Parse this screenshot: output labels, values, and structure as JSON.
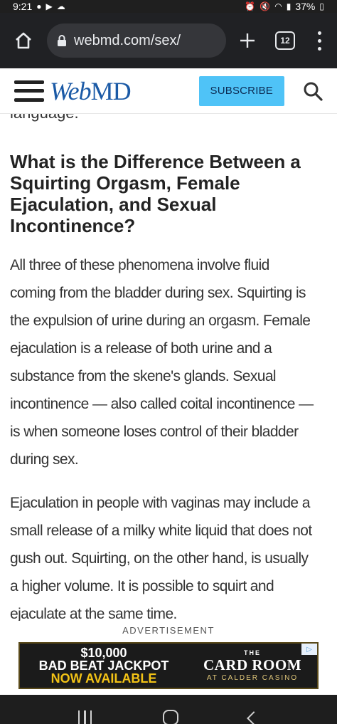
{
  "status_bar": {
    "time": "9:21",
    "battery": "37%"
  },
  "browser": {
    "url": "webmd.com/sex/",
    "tab_count": "12"
  },
  "site": {
    "logo_web": "Web",
    "logo_md": "MD",
    "subscribe_label": "SUBSCRIBE",
    "brand_color": "#1b5aa6",
    "accent_color": "#4fc3f7"
  },
  "article": {
    "cut_text": "language.",
    "heading": "What is the Difference Between a Squirting Orgasm, Female Ejaculation, and Sexual Incontinence?",
    "paragraph1_lines": [
      "All three of these phenomena involve fluid",
      "coming from the bladder during sex. Squirting is",
      "the expulsion of urine during an orgasm. Female",
      "ejaculation is a release of both urine and a",
      "substance from the skene's glands. Sexual",
      "incontinence — also called coital incontinence —",
      " is when someone loses control of their bladder",
      "during sex."
    ],
    "paragraph2_lines": [
      "Ejaculation in people with vaginas may include a",
      "small release of a milky white liquid that does not",
      "gush out. Squirting, on the other hand, is usually",
      "a higher volume. It is possible to squirt and",
      "ejaculate at the same time."
    ]
  },
  "ad": {
    "label": "ADVERTISEMENT",
    "amount": "$10,000",
    "line1": "BAD BEAT JACKPOT",
    "line2": "NOW AVAILABLE",
    "the": "THE",
    "title": "CARD ROOM",
    "subtitle": "AT CALDER CASINO",
    "choice": "▷"
  }
}
